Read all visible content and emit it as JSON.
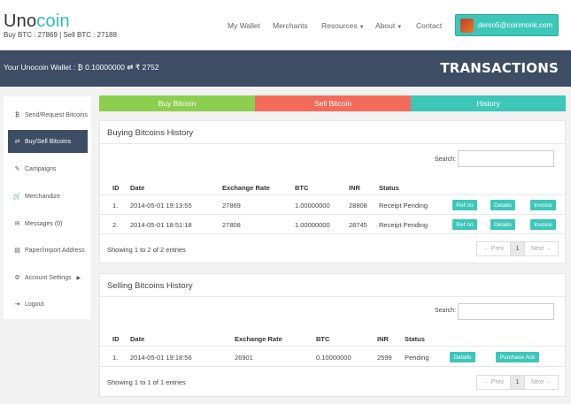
{
  "header": {
    "logo_main": "Uno",
    "logo_accent": "coin",
    "rates": "Buy BTC : 27869 | Sell BTC : 27188",
    "nav": [
      {
        "label": "My Wallet",
        "has_chevron": false
      },
      {
        "label": "Merchants",
        "has_chevron": false
      },
      {
        "label": "Resources",
        "has_chevron": true
      },
      {
        "label": "About",
        "has_chevron": true
      },
      {
        "label": "Contact",
        "has_chevron": false
      }
    ],
    "user_email": "demo5@coinmonk.com"
  },
  "wallet": {
    "text": "Your Unocoin Wallet : ₿ 0.10000000 ⇄ ₹ 2752",
    "page_title": "TRANSACTIONS"
  },
  "sidebar": {
    "items": [
      {
        "label": "Send/Request Bitcoins",
        "icon": "bitcoin-icon",
        "glyph": "₿"
      },
      {
        "label": "Buy/Sell Bitcoins",
        "icon": "exchange-icon",
        "glyph": "⇄"
      },
      {
        "label": "Campaigns",
        "icon": "megaphone-icon",
        "glyph": "✎"
      },
      {
        "label": "Merchandize",
        "icon": "cart-icon",
        "glyph": "🛒"
      },
      {
        "label": "Messages (0)",
        "icon": "envelope-icon",
        "glyph": "✉"
      },
      {
        "label": "Paper/Import Address",
        "icon": "file-icon",
        "glyph": "▤"
      },
      {
        "label": "Account Settings",
        "icon": "gears-icon",
        "glyph": "⚙"
      },
      {
        "label": "Logout",
        "icon": "logout-icon",
        "glyph": "⇥"
      }
    ]
  },
  "tabs": [
    {
      "label": "Buy Bitcoin",
      "color": "#8ccf4f"
    },
    {
      "label": "Sell Bitcoin",
      "color": "#f26b5b"
    },
    {
      "label": "History",
      "color": "#3cc7b9"
    }
  ],
  "buying": {
    "title": "Buying Bitcoins History",
    "search_label": "Search:",
    "columns": [
      "ID",
      "Date",
      "Exchange Rate",
      "BTC",
      "INR",
      "Status"
    ],
    "rows": [
      {
        "id": "1.",
        "date": "2014-05-01 19:13:55",
        "rate": "27869",
        "btc": "1.00000000",
        "inr": "28808",
        "status": "Receipt Pending",
        "actions": [
          "Ref no",
          "Details",
          "Invoice"
        ]
      },
      {
        "id": "2.",
        "date": "2014-05-01 18:51:18",
        "rate": "27808",
        "btc": "1.00000000",
        "inr": "28745",
        "status": "Receipt Pending",
        "actions": [
          "Ref no",
          "Details",
          "Invoice"
        ]
      }
    ],
    "info": "Showing 1 to 2 of 2 entries",
    "pager": {
      "prev": "← Prev",
      "page": "1",
      "next": "Next →"
    }
  },
  "selling": {
    "title": "Selling Bitcoins History",
    "search_label": "Search:",
    "columns": [
      "ID",
      "Date",
      "Exchange Rate",
      "BTC",
      "INR",
      "Status"
    ],
    "rows": [
      {
        "id": "1.",
        "date": "2014-05-01 19:18:56",
        "rate": "26901",
        "btc": "0.10000000",
        "inr": "2599",
        "status": "Pending",
        "actions": [
          "Details",
          "Purchase Ack"
        ]
      }
    ],
    "info": "Showing 1 to 1 of 1 entries",
    "pager": {
      "prev": "← Prev",
      "page": "1",
      "next": "Next →"
    }
  }
}
